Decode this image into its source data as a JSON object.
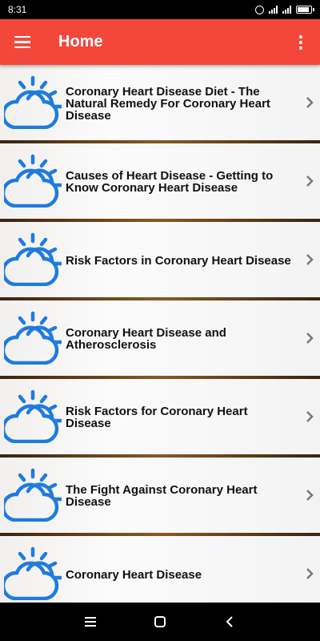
{
  "status": {
    "time": "8:31"
  },
  "appbar": {
    "title": "Home"
  },
  "colors": {
    "appbar": "#f4473c",
    "icon_blue": "#1e7be0"
  },
  "items": [
    {
      "label": "Coronary Heart Disease Diet - The Natural Remedy For Coronary Heart Disease",
      "icon": "sun-cloud-icon"
    },
    {
      "label": "Causes of Heart Disease - Getting to Know Coronary Heart Disease",
      "icon": "sun-cloud-icon"
    },
    {
      "label": "Risk Factors in Coronary Heart Disease",
      "icon": "sun-cloud-icon"
    },
    {
      "label": "Coronary Heart Disease and Atherosclerosis",
      "icon": "sun-cloud-icon"
    },
    {
      "label": "Risk Factors for Coronary Heart Disease",
      "icon": "sun-cloud-icon"
    },
    {
      "label": "The Fight Against Coronary Heart Disease",
      "icon": "sun-cloud-icon"
    },
    {
      "label": "Coronary Heart Disease",
      "icon": "sun-cloud-icon"
    }
  ],
  "navbar": {
    "icons": [
      "recents-icon",
      "home-icon",
      "back-icon"
    ]
  }
}
